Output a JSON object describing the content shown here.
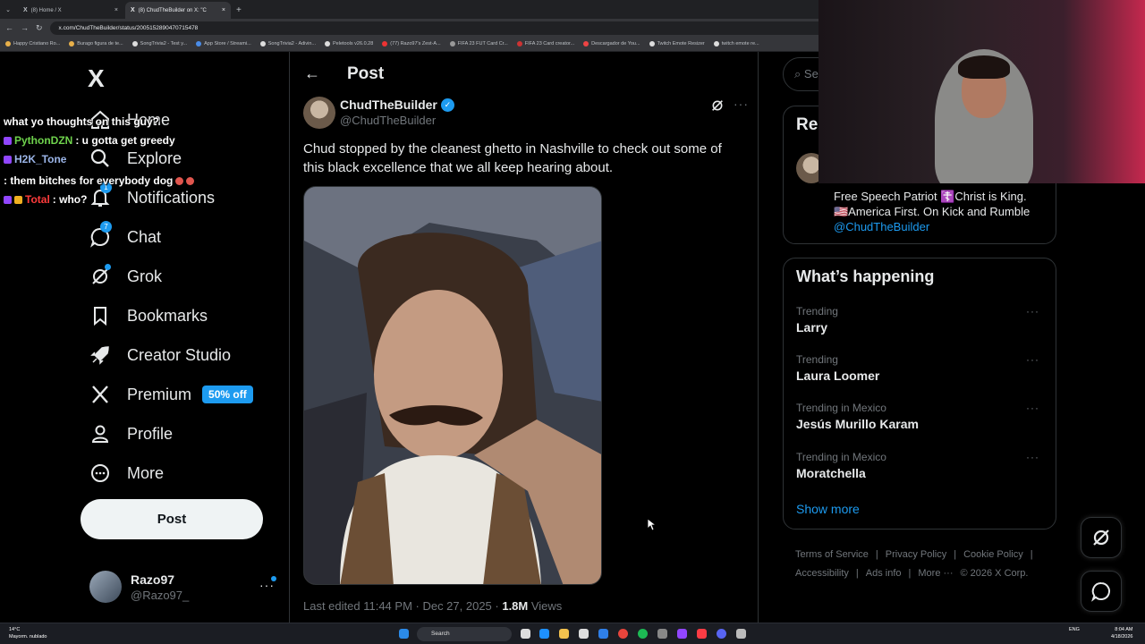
{
  "browser": {
    "tabs": [
      {
        "label": "(8) Home / X",
        "close": "×"
      },
      {
        "label": "(8) ChudTheBuilder on X: \"C",
        "close": "×"
      }
    ],
    "new_tab": "+",
    "url": "x.com/ChudTheBuilder/status/2005152890470715478",
    "bookmarks": [
      "Happy Cristiano Ro...",
      "Burago figura de te...",
      "SongTrivia2 - Test y...",
      "App Store / Streami...",
      "SongTrivia2 - Adivin...",
      "Peletools v26.0.28",
      "(77) Razo97's Zest-A...",
      "FIFA 23 FUT Card Cr...",
      "FIFA 23 Card creator...",
      "Descargador de You...",
      "Twitch Emote Resizer",
      "twitch emote re..."
    ]
  },
  "chat": [
    {
      "user": "",
      "text": "what yo thoughts on this guy?"
    },
    {
      "user": "PythonDZN",
      "text": ": u gotta get greedy"
    },
    {
      "user": "H2K_Tone",
      "text": ": them bitches for everybody dog"
    },
    {
      "user": "Total",
      "text": ": who?"
    }
  ],
  "nav": {
    "logo": "X",
    "items": [
      {
        "label": "Home",
        "icon": "home-icon"
      },
      {
        "label": "Explore",
        "icon": "search-icon"
      },
      {
        "label": "Notifications",
        "icon": "bell-icon",
        "badge": "1"
      },
      {
        "label": "Chat",
        "icon": "chat-icon",
        "badge": "7"
      },
      {
        "label": "Grok",
        "icon": "grok-icon"
      },
      {
        "label": "Bookmarks",
        "icon": "bookmark-icon"
      },
      {
        "label": "Creator Studio",
        "icon": "rocket-icon"
      },
      {
        "label": "Premium",
        "icon": "x-icon",
        "promo": "50% off"
      },
      {
        "label": "Profile",
        "icon": "person-icon"
      },
      {
        "label": "More",
        "icon": "more-circle-icon"
      }
    ],
    "post_button": "Post",
    "account": {
      "name": "Razo97",
      "handle": "@Razo97_",
      "more": "···"
    }
  },
  "main": {
    "back": "←",
    "title": "Post",
    "author": {
      "name": "ChudTheBuilder",
      "handle": "@ChudTheBuilder",
      "verified_mark": "✓"
    },
    "more": "···",
    "text": "Chud stopped by the cleanest ghetto in Nashville to check out some of this black excellence that we all keep hearing about.",
    "meta": {
      "edited": "Last edited 11:44 PM · Dec 27, 2025 · ",
      "views": "1.8M",
      "views_label": " Views"
    }
  },
  "right": {
    "search_placeholder": "Se",
    "relevant_title": "Rel",
    "bio_line1": "Free Speech Patriot ☦️Christ is King.",
    "bio_line2": "🇺🇸America First. On Kick and Rumble",
    "bio_link": "@ChudTheBuilder",
    "happening_title": "What’s happening",
    "trends": [
      {
        "category": "Trending",
        "name": "Larry"
      },
      {
        "category": "Trending",
        "name": "Laura Loomer"
      },
      {
        "category": "Trending in Mexico",
        "name": "Jesús Murillo Karam"
      },
      {
        "category": "Trending in Mexico",
        "name": "Moratchella"
      }
    ],
    "trend_more": "···",
    "show_more": "Show more",
    "footer": [
      "Terms of Service",
      "|",
      "Privacy Policy",
      "|",
      "Cookie Policy",
      "|",
      "Accessibility",
      "|",
      "Ads info",
      "|",
      "More ···",
      "© 2026 X Corp."
    ]
  },
  "taskbar": {
    "temp": "14°C",
    "weather": "Mayorm. nublado",
    "search": "Search",
    "lang": "ENG",
    "time": "8:04 AM",
    "date": "4/18/2026"
  },
  "colors": {
    "accent": "#1d9bf0",
    "background": "#000000",
    "text": "#e7e9ea",
    "muted": "#71767b",
    "border": "#2f3336"
  }
}
